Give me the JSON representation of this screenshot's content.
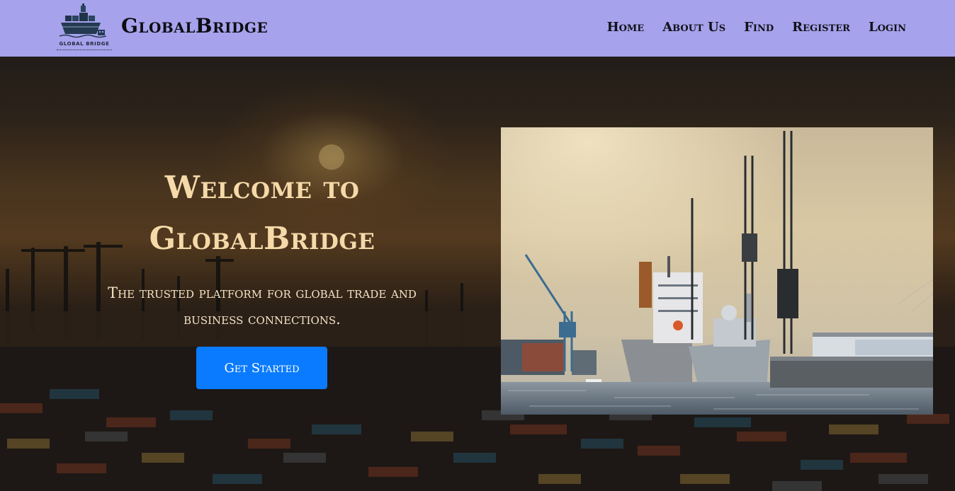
{
  "navbar": {
    "brand_name": "GlobalBridge",
    "logo_text": "GLOBAL BRIDGE",
    "links": [
      "Home",
      "About Us",
      "Find",
      "Register",
      "Login"
    ]
  },
  "hero": {
    "title_line1": "Welcome to",
    "title_line2": "GlobalBridge",
    "subtitle_line1": "The trusted platform for global trade and",
    "subtitle_line2": "business connections.",
    "cta_label": "Get Started"
  },
  "colors": {
    "navbar_bg": "#a7a2ec",
    "title_text": "#f5d9a8",
    "cta_bg": "#0a7bff"
  },
  "icons": {
    "logo": "ship-icon"
  }
}
